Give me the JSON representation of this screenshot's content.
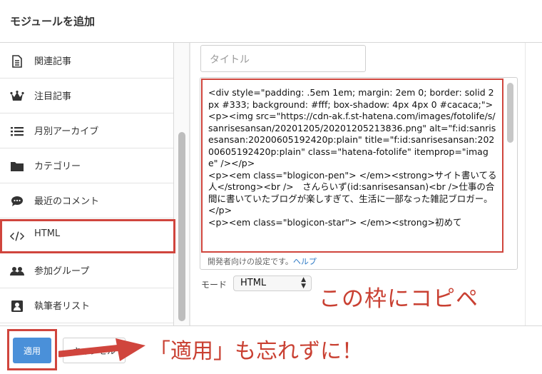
{
  "dialog": {
    "title": "モジュールを追加"
  },
  "sidebar": {
    "items": [
      {
        "label": "関連記事",
        "icon": "document-icon"
      },
      {
        "label": "注目記事",
        "icon": "crown-icon"
      },
      {
        "label": "月別アーカイブ",
        "icon": "list-icon"
      },
      {
        "label": "カテゴリー",
        "icon": "folder-icon"
      },
      {
        "label": "最近のコメント",
        "icon": "comment-icon"
      },
      {
        "label": "HTML",
        "icon": "code-icon",
        "selected": true
      },
      {
        "label": "参加グループ",
        "icon": "group-icon"
      },
      {
        "label": "執筆者リスト",
        "icon": "contact-card-icon"
      }
    ]
  },
  "editor": {
    "title_placeholder": "タイトル",
    "code": "<div style=\"padding: .5em 1em; margin: 2em 0; border: solid 2px #333; background: #fff; box-shadow: 4px 4px 0 #cacaca;\">\n<p><img src=\"https://cdn-ak.f.st-hatena.com/images/fotolife/s/sanrisesansan/20201205/20201205213836.png\" alt=\"f:id:sanrisesansan:20200605192420p:plain\" title=\"f:id:sanrisesansan:20200605192420p:plain\" class=\"hatena-fotolife\" itemprop=\"image\" /></p>\n<p><em class=\"blogicon-pen\"> </em><strong>サイト書いてる人</strong><br />　さんらいず(id:sanrisesansan)<br />仕事の合間に書いていたブログが楽しすぎて、生活に一部なった雑記ブロガー。</p>\n<p><em class=\"blogicon-star\"> </em><strong>初めて",
    "dev_note": "開発者向けの設定です。",
    "help_link": "ヘルプ",
    "mode_label": "モード",
    "mode_value": "HTML"
  },
  "footer": {
    "apply_label": "適用",
    "cancel_label": "キャンセル"
  },
  "annotations": {
    "copy_here": "この枠にコピペ",
    "dont_forget_apply": "「適用」も忘れずに！",
    "highlight_color": "#d0453d"
  },
  "colors": {
    "primary_button": "#4a90d9",
    "link": "#2b78c5"
  }
}
